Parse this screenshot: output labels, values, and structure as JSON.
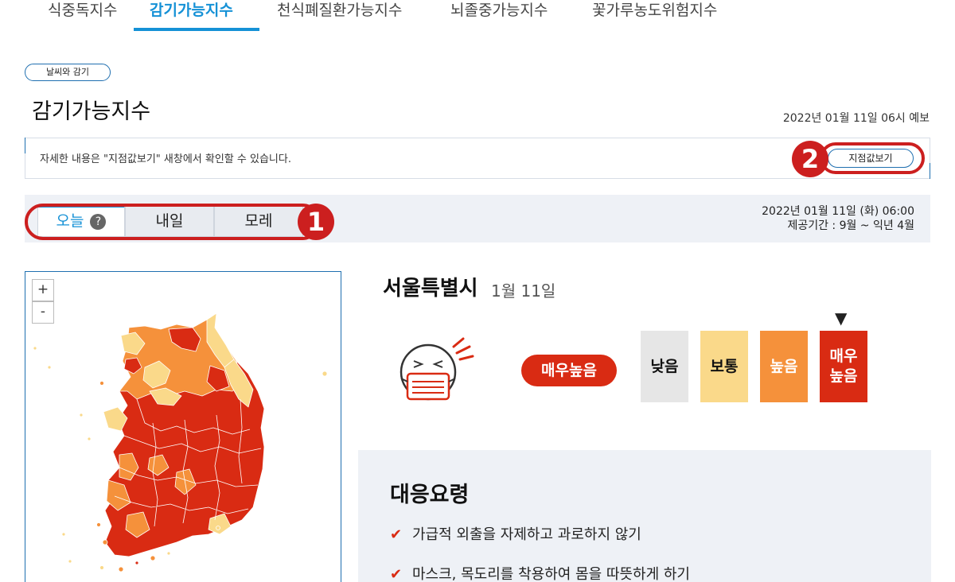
{
  "top_tabs": [
    {
      "label": "식중독지수"
    },
    {
      "label": "감기가능지수"
    },
    {
      "label": "천식폐질환가능지수"
    },
    {
      "label": "뇌졸중가능지수"
    },
    {
      "label": "꽃가루농도위험지수"
    }
  ],
  "breadcrumb": "날씨와 감기",
  "page_title": "감기가능지수",
  "forecast_time": "2022년 01월 11일 06시 예보",
  "notice": {
    "text": "자세한 내용은 \"지점값보기\" 새창에서 확인할 수 있습니다.",
    "button_label": "지점값보기"
  },
  "callouts": {
    "one": "1",
    "two": "2"
  },
  "day_tabs": [
    {
      "label": "오늘"
    },
    {
      "label": "내일"
    },
    {
      "label": "모레"
    }
  ],
  "help_icon": "?",
  "bar_date": {
    "line1": "2022년 01월 11일 (화) 06:00",
    "line2": "제공기간 : 9월 ~ 익년 4월"
  },
  "map": {
    "zoom_in": "+",
    "zoom_out": "-"
  },
  "region": {
    "name": "서울특별시",
    "date": "1월 11일"
  },
  "current_level": "매우높음",
  "scale": [
    {
      "label": "낮음",
      "color": "#e6e6e6",
      "text_color": "#111111"
    },
    {
      "label": "보통",
      "color": "#fad98a",
      "text_color": "#111111"
    },
    {
      "label": "높음",
      "color": "#f5913b",
      "text_color": "#ffffff"
    },
    {
      "label": "매우\n높음",
      "color": "#d92b13",
      "text_color": "#ffffff"
    }
  ],
  "scale_marker": "▼",
  "response": {
    "title": "대응요령",
    "items": [
      "가급적 외출을 자제하고 과로하지 않기",
      "마스크, 목도리를 착용하여 몸을 따뜻하게 하기"
    ]
  }
}
